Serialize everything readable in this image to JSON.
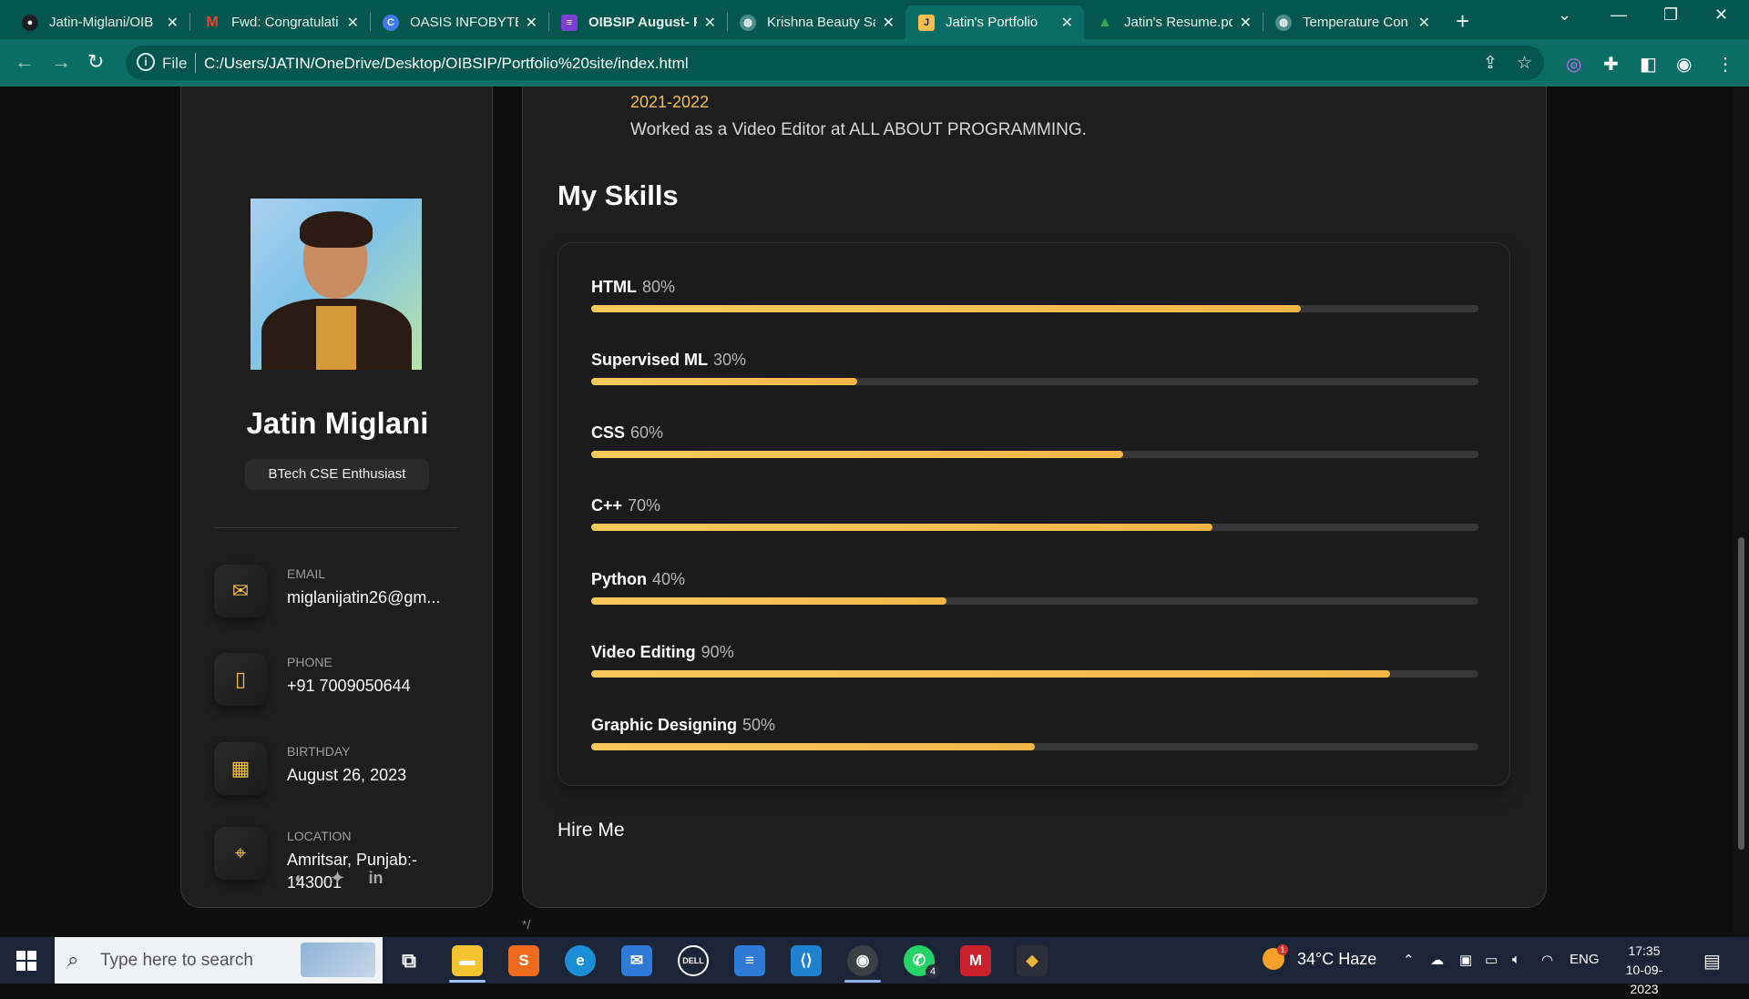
{
  "browser": {
    "tabs": [
      {
        "title": "Jatin-Miglani/OIB",
        "icon": "github-icon",
        "color": "#ffffff"
      },
      {
        "title": "Fwd: Congratulati",
        "icon": "gmail-icon",
        "color": "#ea4335"
      },
      {
        "title": "OASIS INFOBYTE",
        "icon": "canva-icon",
        "color": "#3f7be8"
      },
      {
        "title": "OIBSIP August- F",
        "icon": "forms-icon",
        "color": "#7b3fd1"
      },
      {
        "title": "Krishna Beauty Sa",
        "icon": "globe-icon",
        "color": "#9fc0bd"
      },
      {
        "title": "Jatin's Portfolio",
        "icon": "portfolio-icon",
        "color": "#f3c04f"
      },
      {
        "title": "Jatin's Resume.pd",
        "icon": "drive-icon",
        "color": "#34a853"
      },
      {
        "title": "Temperature Con",
        "icon": "globe-icon",
        "color": "#9fc0bd"
      }
    ],
    "active_tab": 5,
    "address": {
      "scheme_label": "File",
      "url": "C:/Users/JATIN/OneDrive/Desktop/OIBSIP/Portfolio%20site/index.html"
    }
  },
  "profile": {
    "name": "Jatin Miglani",
    "role": "BTech CSE Enthusiast",
    "contacts": [
      {
        "label": "Email",
        "value": "miglanijatin26@gm...",
        "icon": "mail-icon"
      },
      {
        "label": "Phone",
        "value": "+91 7009050644",
        "icon": "phone-icon"
      },
      {
        "label": "Birthday",
        "value": "August 26, 2023",
        "icon": "calendar-icon"
      },
      {
        "label": "Location",
        "value": "Amritsar, Punjab:- 143001",
        "icon": "location-pin-icon"
      }
    ],
    "socials": [
      "github-icon",
      "twitter-icon",
      "linkedin-icon"
    ]
  },
  "timeline": {
    "year": "2021-2022",
    "text": "Worked as a Video Editor at ALL ABOUT PROGRAMMING."
  },
  "skills": {
    "title": "My Skills",
    "items": [
      {
        "name": "HTML",
        "pct_label": "80%",
        "value": 80
      },
      {
        "name": "Supervised ML",
        "pct_label": "30%",
        "value": 30
      },
      {
        "name": "CSS",
        "pct_label": "60%",
        "value": 60
      },
      {
        "name": "C++",
        "pct_label": "70%",
        "value": 70
      },
      {
        "name": "Python",
        "pct_label": "40%",
        "value": 40
      },
      {
        "name": "Video Editing",
        "pct_label": "90%",
        "value": 90
      },
      {
        "name": "Graphic Designing",
        "pct_label": "50%",
        "value": 50
      }
    ]
  },
  "hire_label": "Hire Me",
  "stray_text": "*/",
  "accent_color": "#f3c04f",
  "taskbar": {
    "search_placeholder": "Type here to search",
    "weather": "34°C  Haze",
    "lang": "ENG",
    "time": "17:35",
    "date": "10-09-2023",
    "whatsapp_badge": "4",
    "weather_badge": "1"
  }
}
